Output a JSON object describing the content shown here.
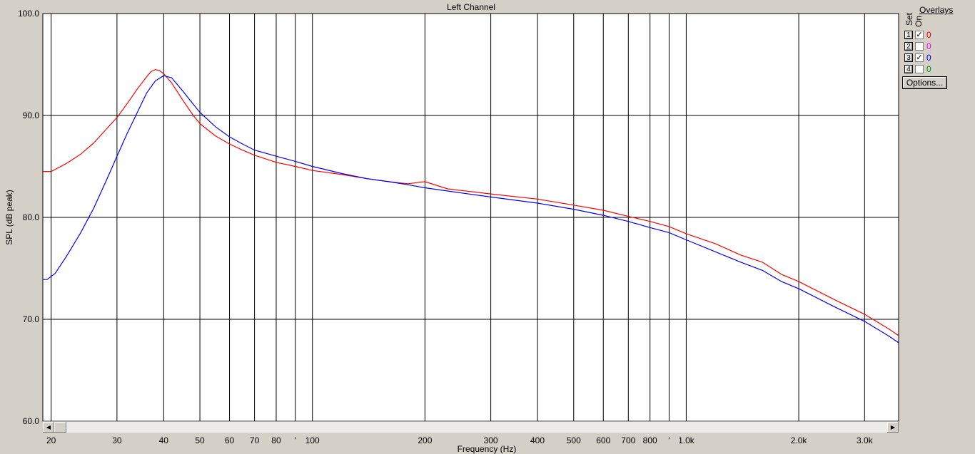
{
  "chart_data": {
    "type": "line",
    "title": "Left Channel",
    "xlabel": "Frequency (Hz)",
    "ylabel": "SPL (dB peak)",
    "xscale": "log",
    "xlim": [
      19,
      3700
    ],
    "ylim": [
      60,
      100
    ],
    "grid": true,
    "yticks": [
      {
        "value": 60,
        "label": "60.0"
      },
      {
        "value": 70,
        "label": "70.0"
      },
      {
        "value": 80,
        "label": "80.0"
      },
      {
        "value": 90,
        "label": "90.0"
      },
      {
        "value": 100,
        "label": "100.0"
      }
    ],
    "xticks": [
      {
        "value": 20,
        "label": "20"
      },
      {
        "value": 30,
        "label": "30"
      },
      {
        "value": 40,
        "label": "40"
      },
      {
        "value": 50,
        "label": "50"
      },
      {
        "value": 60,
        "label": "60"
      },
      {
        "value": 70,
        "label": "70"
      },
      {
        "value": 80,
        "label": "80"
      },
      {
        "value": 90,
        "label": "'"
      },
      {
        "value": 100,
        "label": "100"
      },
      {
        "value": 200,
        "label": "200"
      },
      {
        "value": 300,
        "label": "300"
      },
      {
        "value": 400,
        "label": "400"
      },
      {
        "value": 500,
        "label": "500"
      },
      {
        "value": 600,
        "label": "600"
      },
      {
        "value": 700,
        "label": "700"
      },
      {
        "value": 800,
        "label": "800"
      },
      {
        "value": 900,
        "label": "'"
      },
      {
        "value": 1000,
        "label": "1.0k"
      },
      {
        "value": 2000,
        "label": "2.0k"
      },
      {
        "value": 3000,
        "label": "3.0k"
      }
    ],
    "series": [
      {
        "color": "#ff0000",
        "points": [
          [
            19,
            84.5
          ],
          [
            20,
            84.5
          ],
          [
            22,
            85.3
          ],
          [
            24,
            86.2
          ],
          [
            26,
            87.3
          ],
          [
            28,
            88.6
          ],
          [
            30,
            89.8
          ],
          [
            32,
            91.2
          ],
          [
            34,
            92.6
          ],
          [
            36,
            93.8
          ],
          [
            37,
            94.3
          ],
          [
            38,
            94.5
          ],
          [
            39,
            94.4
          ],
          [
            40,
            94.1
          ],
          [
            42,
            93.2
          ],
          [
            45,
            91.5
          ],
          [
            48,
            90.0
          ],
          [
            50,
            89.2
          ],
          [
            55,
            88.0
          ],
          [
            60,
            87.2
          ],
          [
            65,
            86.6
          ],
          [
            70,
            86.1
          ],
          [
            80,
            85.4
          ],
          [
            90,
            85.0
          ],
          [
            100,
            84.6
          ],
          [
            120,
            84.2
          ],
          [
            140,
            83.8
          ],
          [
            160,
            83.5
          ],
          [
            180,
            83.3
          ],
          [
            200,
            83.5
          ],
          [
            230,
            82.8
          ],
          [
            300,
            82.3
          ],
          [
            400,
            81.8
          ],
          [
            500,
            81.2
          ],
          [
            600,
            80.7
          ],
          [
            700,
            80.1
          ],
          [
            800,
            79.6
          ],
          [
            900,
            79.1
          ],
          [
            1000,
            78.4
          ],
          [
            1200,
            77.4
          ],
          [
            1400,
            76.3
          ],
          [
            1600,
            75.6
          ],
          [
            1800,
            74.4
          ],
          [
            2000,
            73.7
          ],
          [
            2500,
            71.9
          ],
          [
            3000,
            70.5
          ],
          [
            3500,
            69.0
          ],
          [
            3700,
            68.4
          ]
        ]
      },
      {
        "color": "#0000ff",
        "points": [
          [
            19,
            73.9
          ],
          [
            19.5,
            73.9
          ],
          [
            20.5,
            74.5
          ],
          [
            22,
            76.2
          ],
          [
            24,
            78.5
          ],
          [
            26,
            80.9
          ],
          [
            28,
            83.5
          ],
          [
            30,
            86.0
          ],
          [
            32,
            88.3
          ],
          [
            34,
            90.3
          ],
          [
            36,
            92.2
          ],
          [
            38,
            93.4
          ],
          [
            40,
            93.9
          ],
          [
            42,
            93.7
          ],
          [
            45,
            92.4
          ],
          [
            48,
            91.1
          ],
          [
            50,
            90.3
          ],
          [
            55,
            88.9
          ],
          [
            60,
            87.9
          ],
          [
            65,
            87.2
          ],
          [
            70,
            86.6
          ],
          [
            80,
            86.0
          ],
          [
            90,
            85.5
          ],
          [
            100,
            85.0
          ],
          [
            120,
            84.3
          ],
          [
            140,
            83.8
          ],
          [
            160,
            83.5
          ],
          [
            180,
            83.2
          ],
          [
            200,
            82.9
          ],
          [
            250,
            82.4
          ],
          [
            300,
            82.0
          ],
          [
            400,
            81.4
          ],
          [
            500,
            80.8
          ],
          [
            600,
            80.2
          ],
          [
            700,
            79.6
          ],
          [
            800,
            79.0
          ],
          [
            900,
            78.5
          ],
          [
            1000,
            77.8
          ],
          [
            1200,
            76.6
          ],
          [
            1400,
            75.6
          ],
          [
            1600,
            74.8
          ],
          [
            1800,
            73.7
          ],
          [
            2000,
            73.0
          ],
          [
            2500,
            71.2
          ],
          [
            3000,
            69.8
          ],
          [
            3500,
            68.3
          ],
          [
            3700,
            67.7
          ]
        ]
      }
    ]
  },
  "overlays": {
    "title": "Overlays",
    "set_header": "Set",
    "on_header": "On",
    "rows": [
      {
        "set": "1",
        "checked": true,
        "value": "0",
        "color": "#ff0000"
      },
      {
        "set": "2",
        "checked": false,
        "value": "0",
        "color": "#ff00ff"
      },
      {
        "set": "3",
        "checked": true,
        "value": "0",
        "color": "#0000ff"
      },
      {
        "set": "4",
        "checked": false,
        "value": "0",
        "color": "#009900"
      }
    ],
    "options_label": "Options..."
  }
}
